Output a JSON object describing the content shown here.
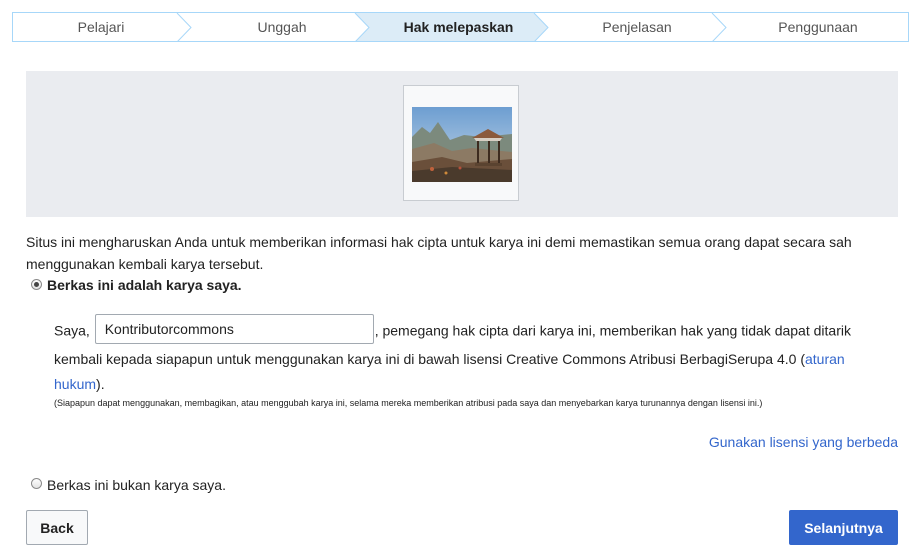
{
  "steps": {
    "items": [
      {
        "label": "Pelajari"
      },
      {
        "label": "Unggah"
      },
      {
        "label": "Hak melepaskan"
      },
      {
        "label": "Penjelasan"
      },
      {
        "label": "Penggunaan"
      }
    ],
    "active_index": 2
  },
  "intro_text": "Situs ini mengharuskan Anda untuk memberikan informasi hak cipta untuk karya ini demi memastikan semua orang dapat secara sah menggunakan kembali karya tersebut.",
  "own_work": {
    "label": "Berkas ini adalah karya saya.",
    "selected": true,
    "prefix": "Saya,",
    "name_value": "Kontributorcommons",
    "statement": ", pemegang hak cipta dari karya ini, memberikan hak yang tidak dapat ditarik kembali kepada siapapun untuk menggunakan karya ini di bawah lisensi Creative Commons Atribusi BerbagiSerupa 4.0 (",
    "legal_link": "aturan hukum",
    "suffix": ").",
    "note": "(Siapapun dapat menggunakan, membagikan, atau menggubah karya ini, selama mereka memberikan atribusi pada saya dan menyebarkan karya turunannya dengan lisensi ini.)",
    "alt_license_link": "Gunakan lisensi yang berbeda"
  },
  "not_own_work": {
    "label": "Berkas ini bukan karya saya.",
    "selected": false
  },
  "buttons": {
    "back": "Back",
    "next": "Selanjutnya"
  },
  "colors": {
    "active_step_bg": "#dcecf7",
    "step_border": "#a7d7f9",
    "preview_bg": "#eaecf0",
    "link": "#3366cc",
    "primary_button": "#3366cc"
  }
}
